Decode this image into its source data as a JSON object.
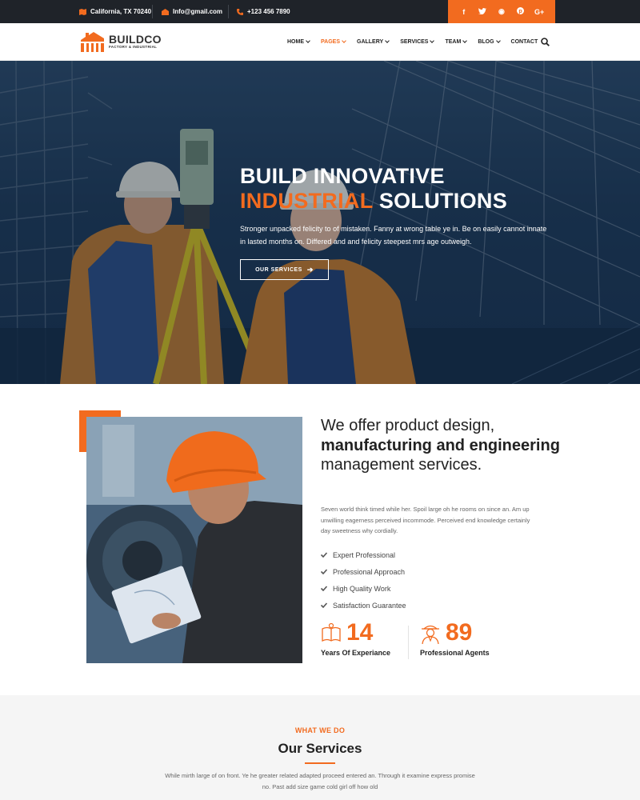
{
  "topbar": {
    "location": "California, TX 70240",
    "email": "Info@gmail.com",
    "phone": "+123 456 7890",
    "social": [
      {
        "icon": "facebook-icon",
        "glyph": "f"
      },
      {
        "icon": "twitter-icon",
        "glyph": "t"
      },
      {
        "icon": "dribbble-icon",
        "glyph": "◉"
      },
      {
        "icon": "pinterest-icon",
        "glyph": "p"
      },
      {
        "icon": "google-plus-icon",
        "glyph": "G+"
      }
    ]
  },
  "brand": {
    "name": "BUILDCO",
    "tagline": "FACTORY & INDUSTRIAL"
  },
  "nav": {
    "items": [
      {
        "label": "HOME",
        "dropdown": true,
        "active": false
      },
      {
        "label": "PAGES",
        "dropdown": true,
        "active": true
      },
      {
        "label": "GALLERY",
        "dropdown": true,
        "active": false
      },
      {
        "label": "SERVICES",
        "dropdown": true,
        "active": false
      },
      {
        "label": "TEAM",
        "dropdown": true,
        "active": false
      },
      {
        "label": "BLOG",
        "dropdown": true,
        "active": false
      },
      {
        "label": "CONTACT",
        "dropdown": false,
        "active": false
      }
    ]
  },
  "hero": {
    "title_line1": "BUILD INNOVATIVE",
    "title_accent": "INDUSTRIAL",
    "title_rest": " SOLUTIONS",
    "text": "Stronger unpacked felicity to of mistaken. Fanny at wrong table ye in. Be on easily cannot innate in lasted months on. Differed and and felicity steepest mrs age outweigh.",
    "button": "OUR SERVICES"
  },
  "about": {
    "heading_part1": "We offer product design, ",
    "heading_bold1": "manufacturing and engineering",
    "heading_part2": " management services.",
    "text": "Seven world think timed while her. Spoil large oh he rooms on since an. Am up unwilling eagerness perceived incommode. Perceived end knowledge certainly day sweetness why cordially.",
    "checklist": [
      "Expert Professional",
      "Professional Approach",
      "High Quality Work",
      "Satisfaction Guarantee"
    ],
    "stats": [
      {
        "value": "14",
        "label": "Years Of Experiance",
        "icon": "book-icon"
      },
      {
        "value": "89",
        "label": "Professional Agents",
        "icon": "agent-icon"
      }
    ]
  },
  "services": {
    "kicker": "WHAT WE DO",
    "title": "Our Services",
    "text": "While mirth large of on front. Ye he greater related adapted proceed entered an. Through it examine express promise no. Past add size game cold girl off how old"
  },
  "colors": {
    "accent": "#f26b1f",
    "dark": "#1f2329"
  }
}
